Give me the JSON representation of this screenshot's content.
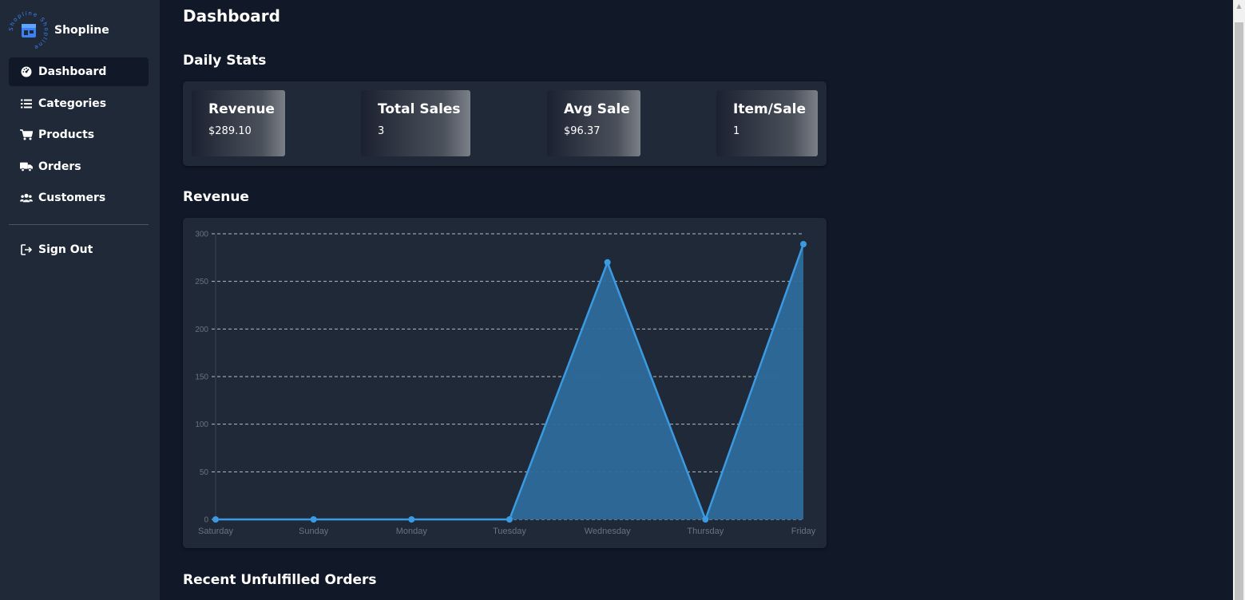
{
  "brand": {
    "name": "Shopline",
    "logo_ring_text": "Shopline Shopline",
    "accent": "#3b82f6"
  },
  "nav": {
    "items": [
      {
        "label": "Dashboard",
        "icon": "gauge-icon",
        "active": true
      },
      {
        "label": "Categories",
        "icon": "list-icon",
        "active": false
      },
      {
        "label": "Products",
        "icon": "cart-icon",
        "active": false
      },
      {
        "label": "Orders",
        "icon": "truck-icon",
        "active": false
      },
      {
        "label": "Customers",
        "icon": "users-icon",
        "active": false
      }
    ],
    "signout": {
      "label": "Sign Out",
      "icon": "sign-out-icon"
    }
  },
  "page": {
    "title": "Dashboard",
    "daily_stats_title": "Daily Stats",
    "revenue_title": "Revenue",
    "recent_orders_title": "Recent Unfulfilled Orders"
  },
  "stats": [
    {
      "label": "Revenue",
      "value": "$289.10"
    },
    {
      "label": "Total Sales",
      "value": "3"
    },
    {
      "label": "Avg Sale",
      "value": "$96.37"
    },
    {
      "label": "Item/Sale",
      "value": "1"
    }
  ],
  "colors": {
    "line": "#3b9ae1",
    "fill": "#2d6a9a",
    "grid": "#d1d5db",
    "tick": "#6b7280"
  },
  "chart_data": {
    "type": "area",
    "categories": [
      "Saturday",
      "Sunday",
      "Monday",
      "Tuesday",
      "Wednesday",
      "Thursday",
      "Friday"
    ],
    "values": [
      0,
      0,
      0,
      0,
      270,
      0,
      289.1
    ],
    "ylim": [
      0,
      300
    ],
    "yticks": [
      0,
      50,
      100,
      150,
      200,
      250,
      300
    ],
    "grid": true,
    "title": "",
    "xlabel": "",
    "ylabel": ""
  }
}
